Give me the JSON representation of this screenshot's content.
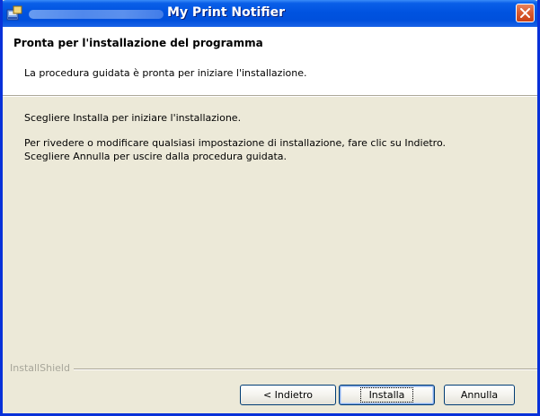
{
  "window": {
    "title": "My Print Notifier",
    "colors": {
      "titlebar": "#0053e0",
      "frame": "#ece9d8",
      "close": "#d95a2e"
    }
  },
  "header": {
    "title": "Pronta per l'installazione del programma",
    "subtitle": "La procedura guidata è pronta per iniziare l'installazione."
  },
  "body": {
    "line1": "Scegliere Installa per iniziare l'installazione.",
    "line2": "Per rivedere o modificare qualsiasi impostazione di installazione, fare clic su Indietro.",
    "line3": "Scegliere Annulla per uscire dalla procedura guidata."
  },
  "footer": {
    "brand": "InstallShield",
    "buttons": {
      "back": "< Indietro",
      "install": "Installa",
      "cancel": "Annulla"
    }
  },
  "icons": {
    "app": "installer-app-icon",
    "close": "close-icon"
  }
}
